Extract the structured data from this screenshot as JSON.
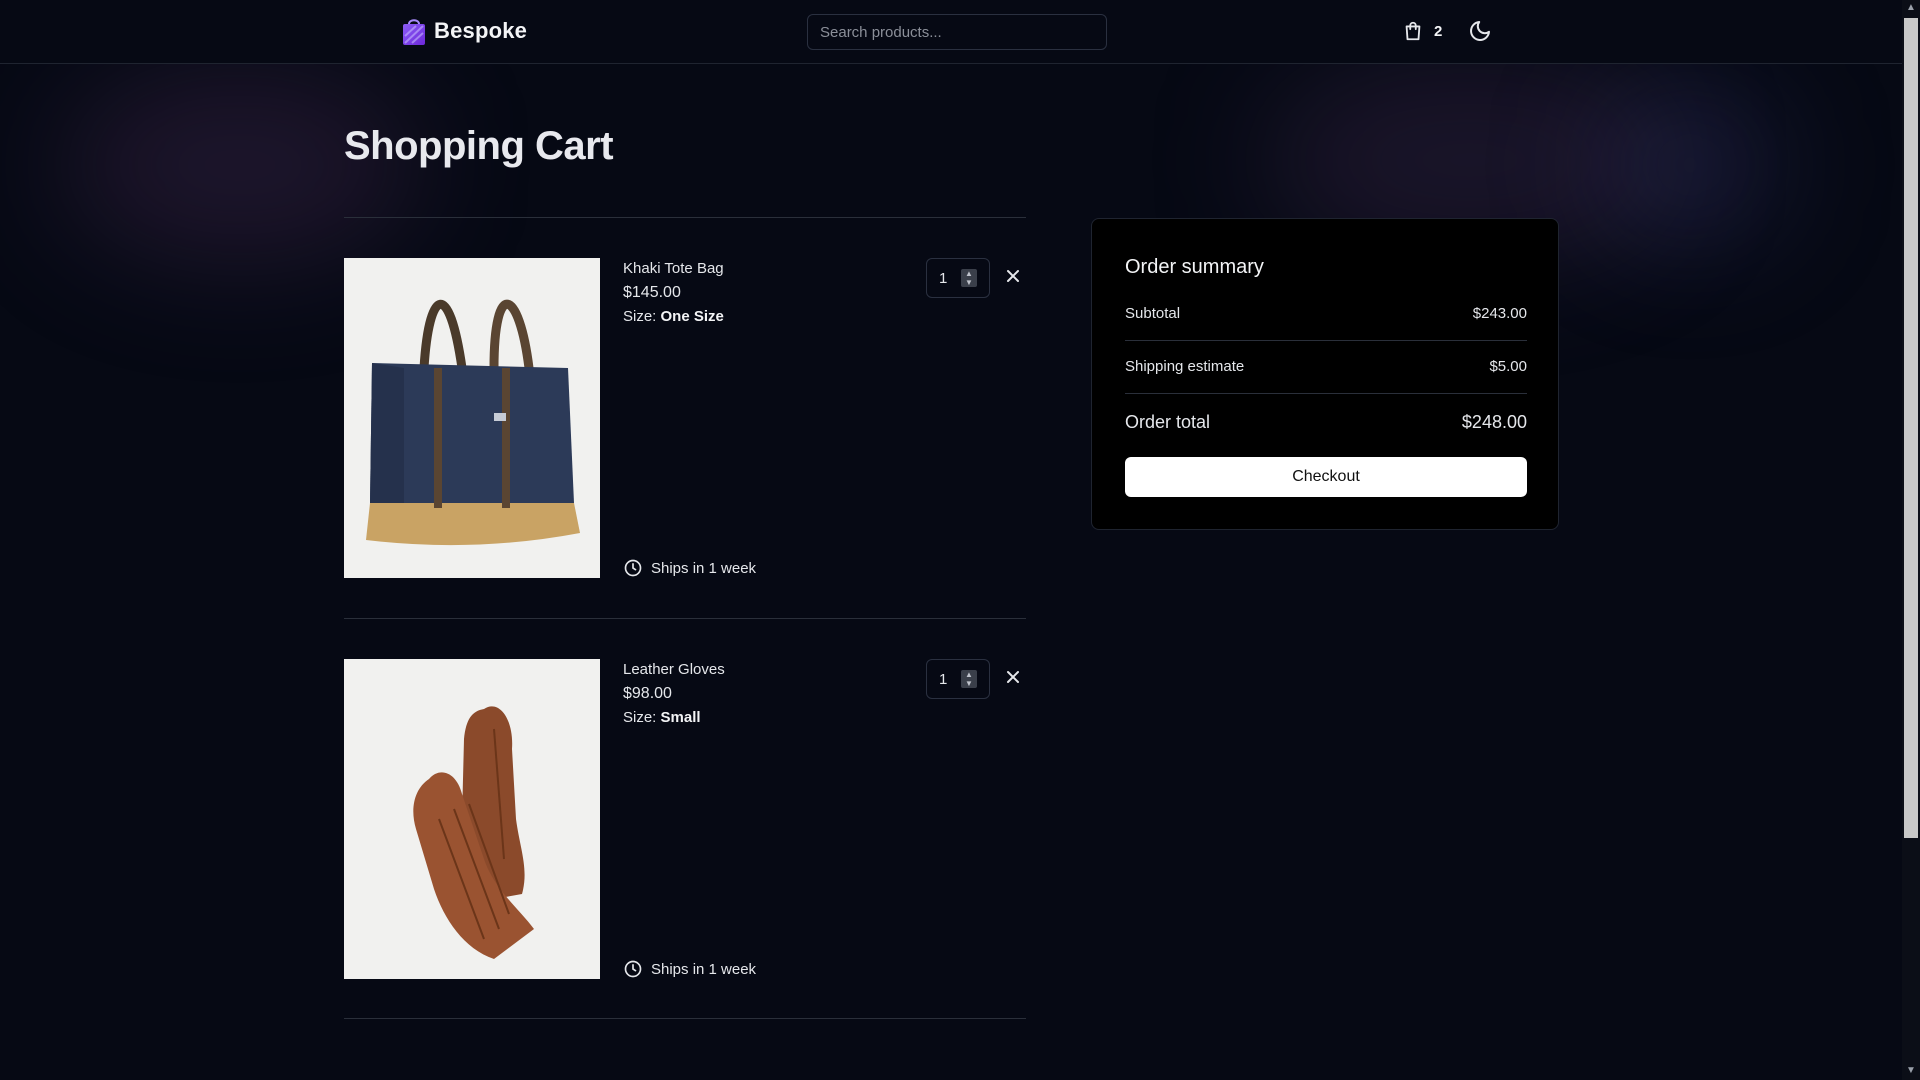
{
  "header": {
    "brand": "Bespoke",
    "search_placeholder": "Search products...",
    "cart_count": "2",
    "cart_icon": "shopping-bag-icon",
    "theme_icon": "moon-icon"
  },
  "page_title": "Shopping Cart",
  "cart": {
    "items": [
      {
        "name": "Khaki Tote Bag",
        "price": "$145.00",
        "size_label": "Size: ",
        "size_value": "One Size",
        "quantity": "1",
        "shipping": "Ships in 1 week",
        "image": "tote-bag-image"
      },
      {
        "name": "Leather Gloves",
        "price": "$98.00",
        "size_label": "Size: ",
        "size_value": "Small",
        "quantity": "1",
        "shipping": "Ships in 1 week",
        "image": "leather-gloves-image"
      }
    ]
  },
  "summary": {
    "title": "Order summary",
    "subtotal_label": "Subtotal",
    "subtotal_value": "$243.00",
    "shipping_label": "Shipping estimate",
    "shipping_value": "$5.00",
    "total_label": "Order total",
    "total_value": "$248.00",
    "checkout_label": "Checkout"
  },
  "colors": {
    "background": "#060914",
    "panel": "#000000",
    "button": "#ffffff"
  }
}
